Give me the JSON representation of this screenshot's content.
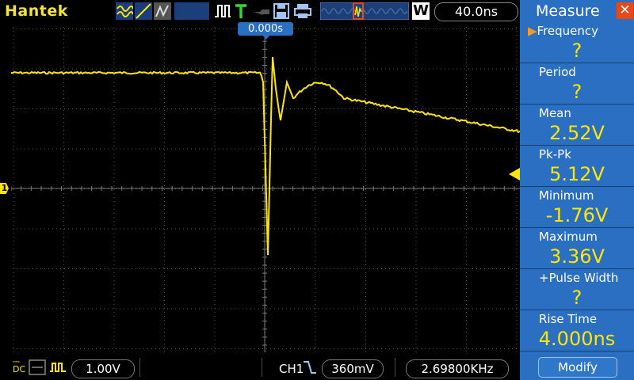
{
  "app": {
    "brand": "Hantek"
  },
  "toolbar": {
    "timebase_value": "40.0ns",
    "window_mode": "W",
    "icons": [
      "trigger-mode-icon",
      "slope-icon",
      "persistence-icon",
      "pulse-icon",
      "trigger-T-icon",
      "run-icon",
      "save-icon",
      "print-icon"
    ]
  },
  "display": {
    "trigger_time_label": "0.000s",
    "channel_marker": "1",
    "trace_color": "#ffe600",
    "grid_color": "#808080"
  },
  "measure": {
    "title": "Measure",
    "items": [
      {
        "label": "Frequency",
        "value": "?",
        "selected": true
      },
      {
        "label": "Period",
        "value": "?"
      },
      {
        "label": "Mean",
        "value": "2.52V"
      },
      {
        "label": "Pk-Pk",
        "value": "5.12V"
      },
      {
        "label": "Minimum",
        "value": "-1.76V"
      },
      {
        "label": "Maximum",
        "value": "3.36V"
      },
      {
        "label": "+Pulse Width",
        "value": "?"
      },
      {
        "label": "Rise Time",
        "value": "4.000ns"
      }
    ],
    "modify_label": "Modify"
  },
  "status": {
    "coupling": "DC",
    "volts_div": "1.00V",
    "trigger_channel": "CH1",
    "trigger_level": "360mV",
    "frequency": "2.69800KHz"
  },
  "colors": {
    "accent": "#2a6fc2",
    "trace": "#ffe600",
    "brand": "#f2e23a",
    "close": "#e8491b"
  }
}
